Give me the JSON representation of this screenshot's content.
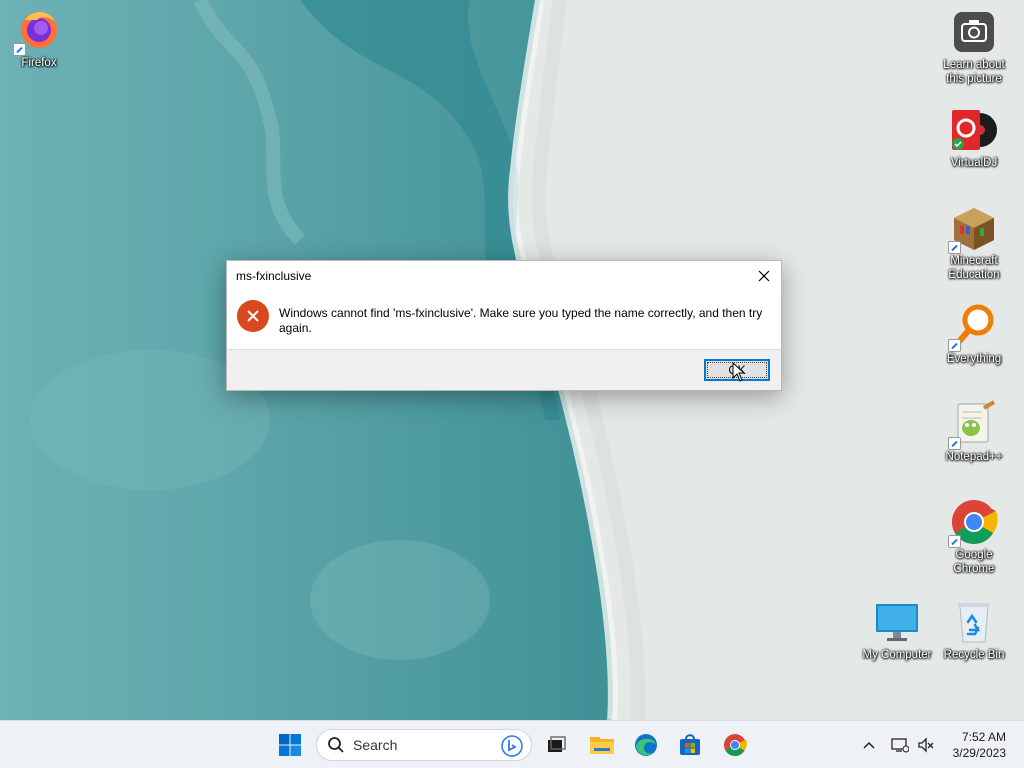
{
  "desktop": {
    "icons": [
      {
        "name": "firefox",
        "label": "Firefox"
      },
      {
        "name": "learn-picture",
        "label": "Learn about this picture"
      },
      {
        "name": "virtualdj",
        "label": "VirtualDJ"
      },
      {
        "name": "minecraft",
        "label": "Minecraft Education"
      },
      {
        "name": "everything",
        "label": "Everything"
      },
      {
        "name": "notepadpp",
        "label": "Notepad++"
      },
      {
        "name": "chrome",
        "label": "Google Chrome"
      },
      {
        "name": "my-computer",
        "label": "My Computer"
      },
      {
        "name": "recycle-bin",
        "label": "Recycle Bin"
      }
    ]
  },
  "dialog": {
    "title": "ms-fxinclusive",
    "message": "Windows cannot find 'ms-fxinclusive'. Make sure you typed the name correctly, and then try again.",
    "ok_label": "OK",
    "icon": "error-icon"
  },
  "taskbar": {
    "search_placeholder": "Search",
    "apps": [
      "start-icon",
      "search-icon",
      "task-view-icon",
      "file-explorer-icon",
      "edge-icon",
      "store-icon",
      "chrome-icon"
    ],
    "tray": [
      "chevron-up-icon",
      "network-icon",
      "volume-muted-icon"
    ],
    "time": "7:52 AM",
    "date": "3/29/2023"
  },
  "colors": {
    "accent": "#0078d4",
    "error": "#d9481f",
    "sea": "#5aa5a8",
    "sand": "#e4e8e7"
  }
}
